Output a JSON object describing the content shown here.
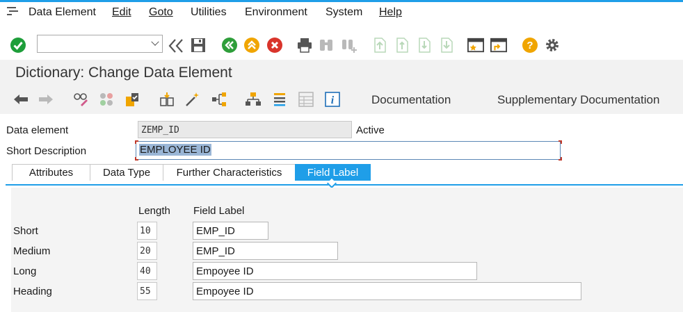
{
  "menu": {
    "items": [
      {
        "label": "Data Element"
      },
      {
        "label": "Edit"
      },
      {
        "label": "Goto"
      },
      {
        "label": "Utilities"
      },
      {
        "label": "Environment"
      },
      {
        "label": "System"
      },
      {
        "label": "Help"
      }
    ]
  },
  "toolbar": {
    "command_field_value": "",
    "icons": [
      "enter-check-icon",
      "command-dropdown-icon",
      "collapse-toolbar-icon",
      "save-icon",
      "back-icon",
      "exit-icon",
      "cancel-icon",
      "print-icon",
      "find-icon",
      "find-next-icon",
      "first-page-icon",
      "previous-page-icon",
      "next-page-icon",
      "last-page-icon",
      "create-session-icon",
      "shortcut-icon",
      "help-icon",
      "settings-icon"
    ]
  },
  "title": "Dictionary: Change Data Element",
  "app_toolbar": {
    "documentation": "Documentation",
    "supplementary_documentation": "Supplementary Documentation"
  },
  "form": {
    "data_element_label": "Data element",
    "data_element_value": "ZEMP_ID",
    "status": "Active",
    "short_description_label": "Short Description",
    "short_description_value": "EMPLOYEE ID"
  },
  "tabs": [
    {
      "label": "Attributes",
      "active": false
    },
    {
      "label": "Data Type",
      "active": false
    },
    {
      "label": "Further Characteristics",
      "active": false
    },
    {
      "label": "Field Label",
      "active": true
    }
  ],
  "field_labels": {
    "length_header": "Length",
    "label_header": "Field Label",
    "rows": [
      {
        "name": "Short",
        "length": "10",
        "label": "EMP_ID"
      },
      {
        "name": "Medium",
        "length": "20",
        "label": "EMP_ID"
      },
      {
        "name": "Long",
        "length": "40",
        "label": "Empoyee ID"
      },
      {
        "name": "Heading",
        "length": "55",
        "label": "Empoyee ID"
      }
    ]
  },
  "colors": {
    "accent": "#1f9ee8",
    "check_green": "#1e9e3a",
    "nav_green": "#2e9e3a",
    "exit_orange": "#f0a500",
    "cancel_red": "#d9342b",
    "help_orange": "#f0a500"
  }
}
